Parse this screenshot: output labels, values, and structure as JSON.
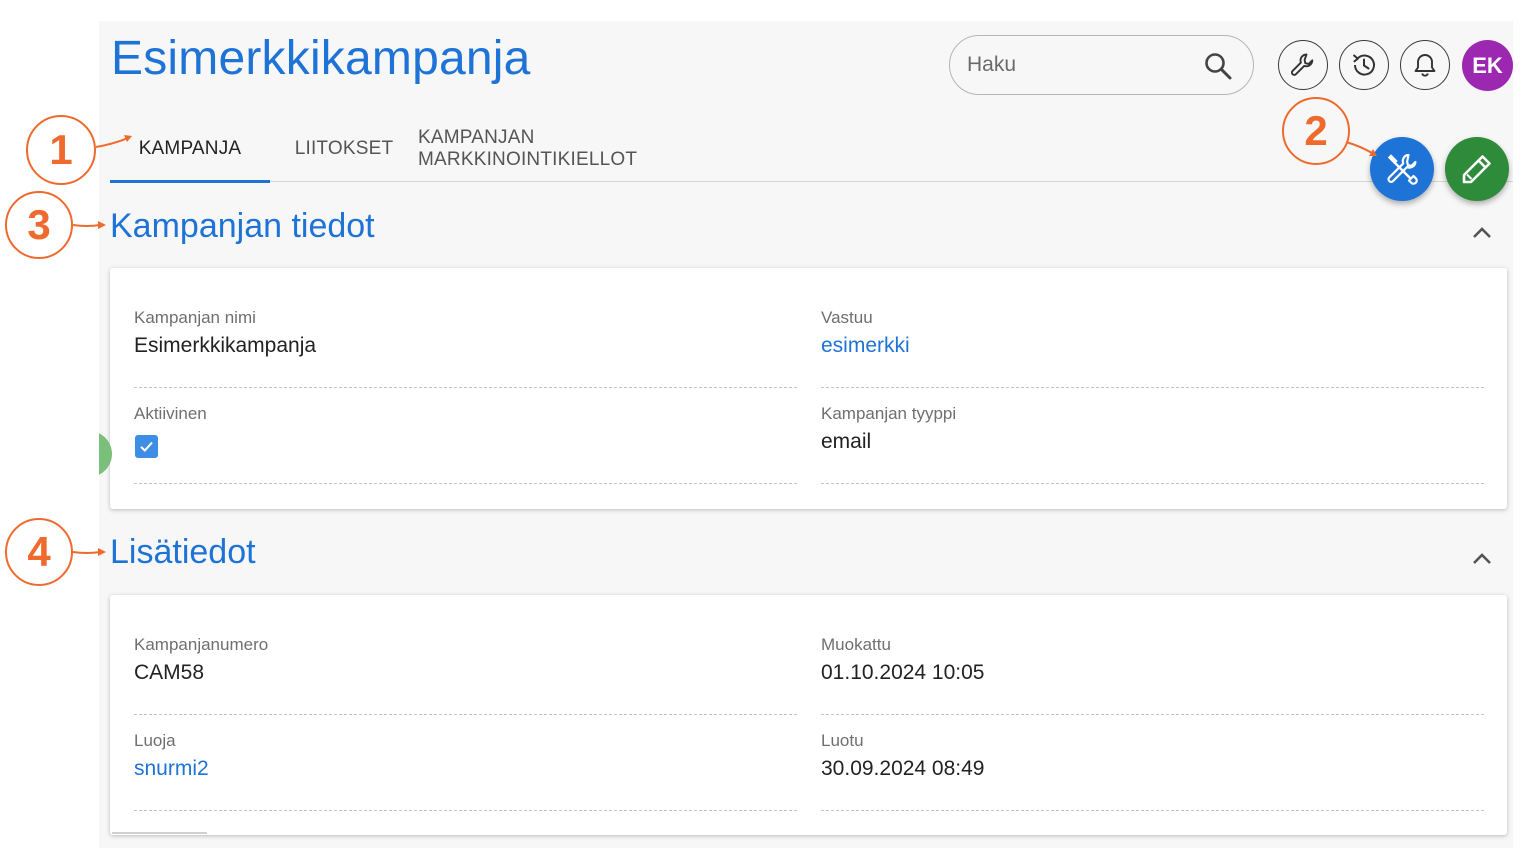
{
  "header": {
    "title": "Esimerkkikampanja",
    "search_placeholder": "Haku",
    "avatar_initials": "EK"
  },
  "icons": {
    "search": "search-icon",
    "settings": "wrench-icon",
    "history": "history-icon",
    "notifications": "bell-icon",
    "tools_fab": "tools-icon",
    "edit_fab": "pencil-icon",
    "collapse": "chevron-up-icon",
    "checkbox": "checkmark-icon"
  },
  "tabs": [
    {
      "label": "KAMPANJA",
      "active": true
    },
    {
      "label": "LIITOKSET",
      "active": false
    },
    {
      "label": "KAMPANJAN MARKKINOINTIKIELLOT",
      "active": false
    }
  ],
  "sections": {
    "campaign_info": {
      "title": "Kampanjan tiedot",
      "fields": {
        "name": {
          "label": "Kampanjan nimi",
          "value": "Esimerkkikampanja"
        },
        "owner": {
          "label": "Vastuu",
          "value": "esimerkki"
        },
        "active": {
          "label": "Aktiivinen",
          "checked": true
        },
        "type": {
          "label": "Kampanjan tyyppi",
          "value": "email"
        }
      }
    },
    "additional_info": {
      "title": "Lisätiedot",
      "fields": {
        "number": {
          "label": "Kampanjanumero",
          "value": "CAM58"
        },
        "modified": {
          "label": "Muokattu",
          "value": "01.10.2024 10:05"
        },
        "creator": {
          "label": "Luoja",
          "value": "snurmi2"
        },
        "created": {
          "label": "Luotu",
          "value": "30.09.2024 08:49"
        }
      }
    }
  },
  "annotations": [
    "1",
    "2",
    "3",
    "4"
  ],
  "colors": {
    "primary": "#1e73d6",
    "edit_fab": "#2e8b3a",
    "avatar": "#9c27b0",
    "annotation": "#ef6a2d"
  }
}
